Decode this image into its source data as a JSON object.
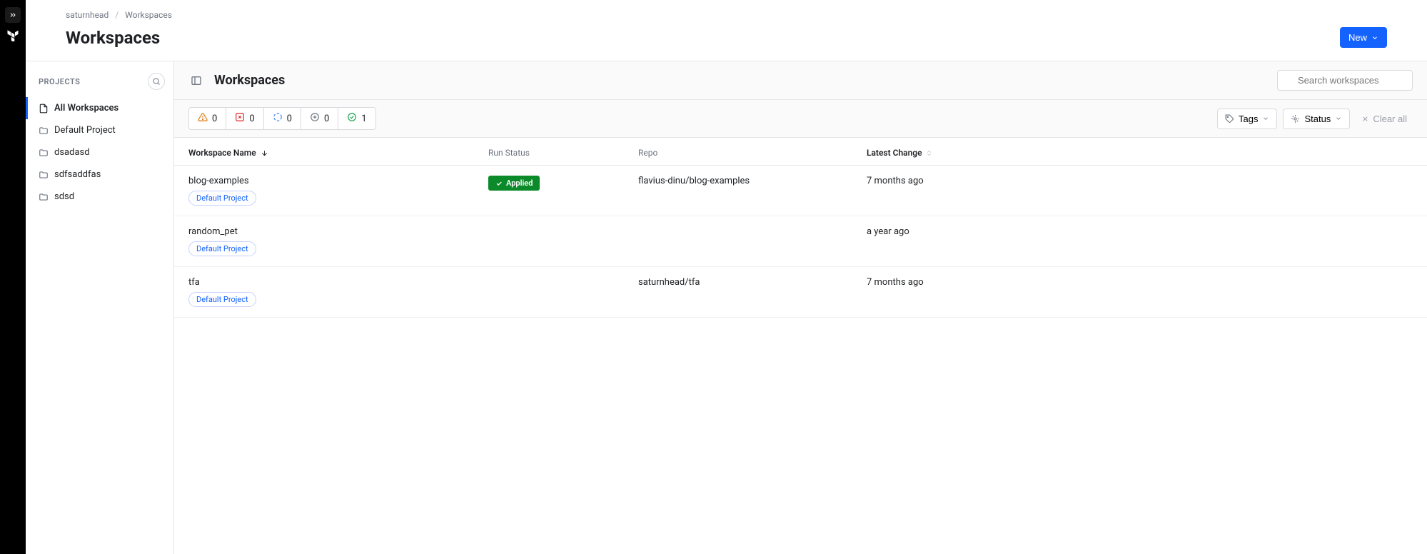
{
  "breadcrumb": {
    "org": "saturnhead",
    "page": "Workspaces"
  },
  "header": {
    "title": "Workspaces",
    "new_label": "New"
  },
  "sidebar": {
    "title": "PROJECTS",
    "items": [
      {
        "label": "All Workspaces",
        "active": true
      },
      {
        "label": "Default Project",
        "active": false
      },
      {
        "label": "dsadasd",
        "active": false
      },
      {
        "label": "sdfsaddfas",
        "active": false
      },
      {
        "label": "sdsd",
        "active": false
      }
    ]
  },
  "panel": {
    "title": "Workspaces",
    "search_placeholder": "Search workspaces",
    "status_counts": [
      {
        "kind": "warning",
        "count": "0"
      },
      {
        "kind": "error",
        "count": "0"
      },
      {
        "kind": "running",
        "count": "0"
      },
      {
        "kind": "pending",
        "count": "0"
      },
      {
        "kind": "applied",
        "count": "1"
      }
    ],
    "filter_tags": "Tags",
    "filter_status": "Status",
    "clear_all": "Clear all"
  },
  "table": {
    "headers": {
      "name": "Workspace Name",
      "status": "Run Status",
      "repo": "Repo",
      "change": "Latest Change"
    },
    "rows": [
      {
        "name": "blog-examples",
        "project": "Default Project",
        "status": "Applied",
        "repo": "flavius-dinu/blog-examples",
        "change": "7 months ago"
      },
      {
        "name": "random_pet",
        "project": "Default Project",
        "status": "",
        "repo": "",
        "change": "a year ago"
      },
      {
        "name": "tfa",
        "project": "Default Project",
        "status": "",
        "repo": "saturnhead/tfa",
        "change": "7 months ago"
      }
    ]
  }
}
